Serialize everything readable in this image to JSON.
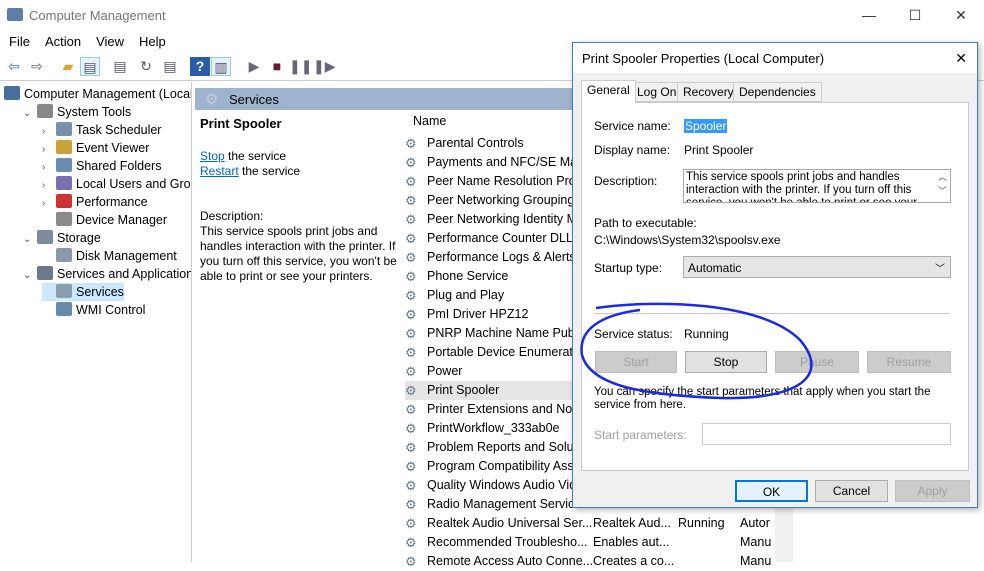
{
  "window": {
    "title": "Computer Management",
    "min": "—",
    "max": "☐",
    "close": "✕"
  },
  "menu": [
    "File",
    "Action",
    "View",
    "Help"
  ],
  "toolbar": {
    "icons": [
      "back-arrow-icon",
      "forward-arrow-icon",
      "up-folder-icon",
      "show-hide-tree-icon",
      "properties-icon",
      "refresh-icon",
      "export-list-icon",
      "help-icon",
      "action-pane-icon",
      "play-icon",
      "stop-icon",
      "pause-icon",
      "resume-icon"
    ]
  },
  "tree": [
    {
      "label": "Computer Management (Local",
      "level": 0,
      "expand": ""
    },
    {
      "label": "System Tools",
      "level": 1,
      "expand": "v"
    },
    {
      "label": "Task Scheduler",
      "level": 2,
      "expand": ">"
    },
    {
      "label": "Event Viewer",
      "level": 2,
      "expand": ">"
    },
    {
      "label": "Shared Folders",
      "level": 2,
      "expand": ">"
    },
    {
      "label": "Local Users and Groups",
      "level": 2,
      "expand": ">"
    },
    {
      "label": "Performance",
      "level": 2,
      "expand": ">"
    },
    {
      "label": "Device Manager",
      "level": 2,
      "expand": ""
    },
    {
      "label": "Storage",
      "level": 1,
      "expand": "v"
    },
    {
      "label": "Disk Management",
      "level": 2,
      "expand": ""
    },
    {
      "label": "Services and Applications",
      "level": 1,
      "expand": "v"
    },
    {
      "label": "Services",
      "level": 2,
      "expand": "",
      "selected": true
    },
    {
      "label": "WMI Control",
      "level": 2,
      "expand": ""
    }
  ],
  "services": {
    "header": "Services",
    "selected_title": "Print Spooler",
    "stop_link": "Stop",
    "stop_rest": " the service",
    "restart_link": "Restart",
    "restart_rest": " the service",
    "desc_label": "Description:",
    "desc_text": "This service spools print jobs and handles interaction with the printer. If you turn off this service, you won't be able to print or see your printers.",
    "col_name": "Name",
    "rows": [
      {
        "name": "Parental Controls",
        "desc": "",
        "status": "",
        "startup": ""
      },
      {
        "name": "Payments and NFC/SE Man",
        "desc": "",
        "status": "",
        "startup": ""
      },
      {
        "name": "Peer Name Resolution Prot",
        "desc": "",
        "status": "",
        "startup": ""
      },
      {
        "name": "Peer Networking Grouping",
        "desc": "",
        "status": "",
        "startup": ""
      },
      {
        "name": "Peer Networking Identity M",
        "desc": "",
        "status": "",
        "startup": ""
      },
      {
        "name": "Performance Counter DLL",
        "desc": "",
        "status": "",
        "startup": ""
      },
      {
        "name": "Performance Logs & Alerts",
        "desc": "",
        "status": "",
        "startup": ""
      },
      {
        "name": "Phone Service",
        "desc": "",
        "status": "",
        "startup": ""
      },
      {
        "name": "Plug and Play",
        "desc": "",
        "status": "",
        "startup": ""
      },
      {
        "name": "PmI Driver HPZ12",
        "desc": "",
        "status": "",
        "startup": ""
      },
      {
        "name": "PNRP Machine Name Publi",
        "desc": "",
        "status": "",
        "startup": ""
      },
      {
        "name": "Portable Device Enumerato",
        "desc": "",
        "status": "",
        "startup": ""
      },
      {
        "name": "Power",
        "desc": "",
        "status": "",
        "startup": ""
      },
      {
        "name": "Print Spooler",
        "desc": "",
        "status": "",
        "startup": "",
        "selected": true
      },
      {
        "name": "Printer Extensions and Noti",
        "desc": "",
        "status": "",
        "startup": ""
      },
      {
        "name": "PrintWorkflow_333ab0e",
        "desc": "",
        "status": "",
        "startup": ""
      },
      {
        "name": "Problem Reports and Soluti",
        "desc": "",
        "status": "",
        "startup": ""
      },
      {
        "name": "Program Compatibility Ass",
        "desc": "",
        "status": "",
        "startup": ""
      },
      {
        "name": "Quality Windows Audio Vid",
        "desc": "",
        "status": "",
        "startup": ""
      },
      {
        "name": "Radio Management Service",
        "desc": "",
        "status": "",
        "startup": ""
      },
      {
        "name": "Realtek Audio Universal Ser...",
        "desc": "Realtek Aud...",
        "status": "Running",
        "startup": "Autor"
      },
      {
        "name": "Recommended Troublesho...",
        "desc": "Enables aut...",
        "status": "",
        "startup": "Manu"
      },
      {
        "name": "Remote Access Auto Conne...",
        "desc": "Creates a co...",
        "status": "",
        "startup": "Manu"
      }
    ]
  },
  "dialog": {
    "title": "Print Spooler Properties (Local Computer)",
    "close": "✕",
    "tabs": [
      "General",
      "Log On",
      "Recovery",
      "Dependencies"
    ],
    "active_tab": "General",
    "service_name_label": "Service name:",
    "service_name": "Spooler",
    "display_name_label": "Display name:",
    "display_name": "Print Spooler",
    "description_label": "Description:",
    "description": "This service spools print jobs and handles interaction with the printer.  If you turn off this service, you won't be able to print or see your printers.",
    "path_label": "Path to executable:",
    "path": "C:\\Windows\\System32\\spoolsv.exe",
    "startup_label": "Startup type:",
    "startup": "Automatic",
    "status_label": "Service status:",
    "status": "Running",
    "buttons": {
      "start": "Start",
      "stop": "Stop",
      "pause": "Pause",
      "resume": "Resume"
    },
    "hint": "You can specify the start parameters that apply when you start the service from here.",
    "params_label": "Start parameters:",
    "params_value": "",
    "ok": "OK",
    "cancel": "Cancel",
    "apply": "Apply"
  },
  "colors": {
    "accent": "#0078d7",
    "selection": "#3399ff",
    "annotation": "#1a2be0",
    "header_band": "#9db4cc"
  }
}
